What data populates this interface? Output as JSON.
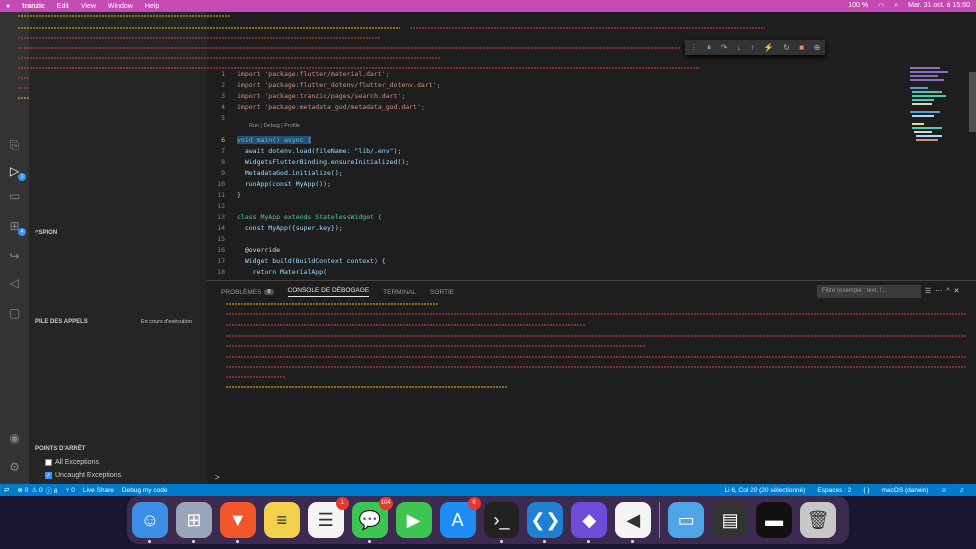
{
  "menubar": {
    "app": "tranzic",
    "items": [
      "Edit",
      "View",
      "Window",
      "Help"
    ],
    "battery": "100 %",
    "datetime": "Mar. 31 oct. à 15:50"
  },
  "sidebar": {
    "variables_header": "^SPION",
    "callstack_header": "PILE DES APPELS",
    "callstack_status": "En cours d'exécution",
    "breakpoints_header": "POINTS D'ARRÊT",
    "breakpoints": [
      {
        "label": "All Exceptions",
        "checked": false
      },
      {
        "label": "Uncaught Exceptions",
        "checked": true
      }
    ]
  },
  "activity_badges": {
    "run": "1",
    "extensions": "4"
  },
  "editor": {
    "codelens": "Run | Debug | Profile",
    "lines": [
      {
        "n": "1",
        "code": "import 'package:flutter/material.dart';"
      },
      {
        "n": "2",
        "code": "import 'package:flutter_dotenv/flutter_dotenv.dart';"
      },
      {
        "n": "3",
        "code": "import 'package:tranzic/pages/search.dart';"
      },
      {
        "n": "4",
        "code": "import 'package:metadata_god/metadata_god.dart';"
      },
      {
        "n": "5",
        "code": ""
      },
      {
        "n": "6",
        "code": "void main() async {"
      },
      {
        "n": "7",
        "code": "  await dotenv.load(fileName: \"lib/.env\");"
      },
      {
        "n": "8",
        "code": "  WidgetsFlutterBinding.ensureInitialized();"
      },
      {
        "n": "9",
        "code": "  MetadataGod.initialize();"
      },
      {
        "n": "10",
        "code": "  runApp(const MyApp());"
      },
      {
        "n": "11",
        "code": "}"
      },
      {
        "n": "12",
        "code": ""
      },
      {
        "n": "13",
        "code": "class MyApp extends StatelessWidget {"
      },
      {
        "n": "14",
        "code": "  const MyApp({super.key});"
      },
      {
        "n": "15",
        "code": ""
      },
      {
        "n": "16",
        "code": "  @override"
      },
      {
        "n": "17",
        "code": "  Widget build(BuildContext context) {"
      },
      {
        "n": "18",
        "code": "    return MaterialApp("
      }
    ]
  },
  "panel": {
    "tabs": [
      {
        "label": "PROBLÈMES",
        "count": "8"
      },
      {
        "label": "CONSOLE DE DÉBOGAGE",
        "count": ""
      },
      {
        "label": "TERMINAL",
        "count": ""
      },
      {
        "label": "SORTIE",
        "count": ""
      }
    ],
    "filter_placeholder": "Filtre (exemple : text, !...",
    "prompt": ">"
  },
  "statusbar": {
    "errors": "⊗ 0",
    "warnings": "⚠ 0",
    "info": "ⓘ 8",
    "ports": "⑂ 0",
    "live_share": "Live Share",
    "debug_mode": "Debug my code",
    "cursor": "Li 6, Col 20 (20 sélectionné)",
    "spaces": "Espaces : 2",
    "braces": "{ }",
    "device": "macOS (darwin)"
  },
  "dock": [
    {
      "name": "finder",
      "badge": ""
    },
    {
      "name": "launchpad",
      "badge": ""
    },
    {
      "name": "brave",
      "badge": ""
    },
    {
      "name": "notes",
      "badge": ""
    },
    {
      "name": "reminders",
      "badge": "1"
    },
    {
      "name": "messages",
      "badge": "104"
    },
    {
      "name": "facetime",
      "badge": ""
    },
    {
      "name": "app-store",
      "badge": "6"
    },
    {
      "name": "terminal",
      "badge": ""
    },
    {
      "name": "vscode",
      "badge": ""
    },
    {
      "name": "obsidian",
      "badge": ""
    },
    {
      "name": "flutter",
      "badge": ""
    },
    {
      "name": "folder",
      "badge": ""
    },
    {
      "name": "window-thumb-1",
      "badge": ""
    },
    {
      "name": "window-thumb-2",
      "badge": ""
    },
    {
      "name": "trash",
      "badge": ""
    }
  ],
  "colors": {
    "accent": "#007acc",
    "overlay_yellow": "#e5c000",
    "overlay_red": "#e04040",
    "menubar": "#c64ab4"
  }
}
